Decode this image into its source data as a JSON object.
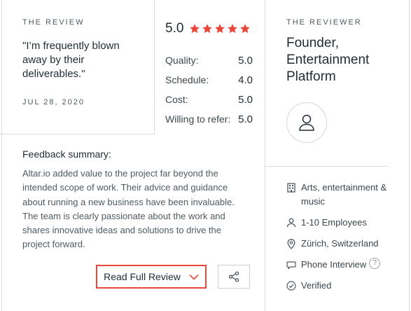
{
  "review": {
    "section_label": "THE REVIEW",
    "quote": "\"I’m frequently blown away by their deliverables.\"",
    "date": "JUL 28, 2020"
  },
  "rating": {
    "overall": "5.0",
    "stars": 5,
    "star_color": "#e8483b",
    "rows": [
      {
        "label": "Quality:",
        "value": "5.0"
      },
      {
        "label": "Schedule:",
        "value": "4.0"
      },
      {
        "label": "Cost:",
        "value": "5.0"
      },
      {
        "label": "Willing to refer:",
        "value": "5.0"
      }
    ]
  },
  "feedback": {
    "title": "Feedback summary:",
    "text": "Altar.io added value to the project far beyond the intended scope of work. Their advice and guidance about running a new business have been invaluable. The team is clearly passionate about the work and shares innovative ideas and solutions to drive the project forward."
  },
  "actions": {
    "read_full_review": "Read Full Review",
    "accent": "#e8483b"
  },
  "reviewer": {
    "section_label": "THE REVIEWER",
    "title": "Founder, Entertainment Platform",
    "industry": "Arts, entertainment & music",
    "employees": "1-10 Employees",
    "location": "Zürich, Switzerland",
    "interview": "Phone Interview",
    "interview_help": "?",
    "verified": "Verified"
  }
}
